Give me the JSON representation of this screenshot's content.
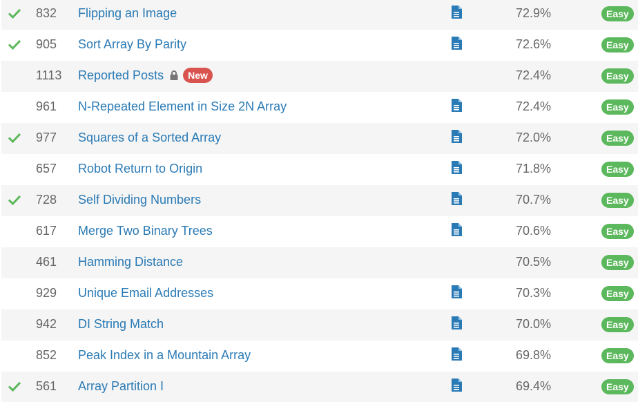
{
  "problems": [
    {
      "solved": true,
      "id": "832",
      "title": "Flipping an Image",
      "locked": false,
      "badge": "",
      "solution": true,
      "acceptance": "72.9%",
      "difficulty": "Easy"
    },
    {
      "solved": true,
      "id": "905",
      "title": "Sort Array By Parity",
      "locked": false,
      "badge": "",
      "solution": true,
      "acceptance": "72.6%",
      "difficulty": "Easy"
    },
    {
      "solved": false,
      "id": "1113",
      "title": "Reported Posts",
      "locked": true,
      "badge": "New",
      "solution": false,
      "acceptance": "72.4%",
      "difficulty": "Easy"
    },
    {
      "solved": false,
      "id": "961",
      "title": "N-Repeated Element in Size 2N Array",
      "locked": false,
      "badge": "",
      "solution": true,
      "acceptance": "72.4%",
      "difficulty": "Easy"
    },
    {
      "solved": true,
      "id": "977",
      "title": "Squares of a Sorted Array",
      "locked": false,
      "badge": "",
      "solution": true,
      "acceptance": "72.0%",
      "difficulty": "Easy"
    },
    {
      "solved": false,
      "id": "657",
      "title": "Robot Return to Origin",
      "locked": false,
      "badge": "",
      "solution": true,
      "acceptance": "71.8%",
      "difficulty": "Easy"
    },
    {
      "solved": true,
      "id": "728",
      "title": "Self Dividing Numbers",
      "locked": false,
      "badge": "",
      "solution": true,
      "acceptance": "70.7%",
      "difficulty": "Easy"
    },
    {
      "solved": false,
      "id": "617",
      "title": "Merge Two Binary Trees",
      "locked": false,
      "badge": "",
      "solution": true,
      "acceptance": "70.6%",
      "difficulty": "Easy"
    },
    {
      "solved": false,
      "id": "461",
      "title": "Hamming Distance",
      "locked": false,
      "badge": "",
      "solution": false,
      "acceptance": "70.5%",
      "difficulty": "Easy"
    },
    {
      "solved": false,
      "id": "929",
      "title": "Unique Email Addresses",
      "locked": false,
      "badge": "",
      "solution": true,
      "acceptance": "70.3%",
      "difficulty": "Easy"
    },
    {
      "solved": false,
      "id": "942",
      "title": "DI String Match",
      "locked": false,
      "badge": "",
      "solution": true,
      "acceptance": "70.0%",
      "difficulty": "Easy"
    },
    {
      "solved": false,
      "id": "852",
      "title": "Peak Index in a Mountain Array",
      "locked": false,
      "badge": "",
      "solution": true,
      "acceptance": "69.8%",
      "difficulty": "Easy"
    },
    {
      "solved": true,
      "id": "561",
      "title": "Array Partition I",
      "locked": false,
      "badge": "",
      "solution": true,
      "acceptance": "69.4%",
      "difficulty": "Easy"
    }
  ],
  "icons": {
    "solved": "check-icon",
    "locked": "lock-icon",
    "solution": "solution-document-icon"
  },
  "colors": {
    "link": "#2a7ab5",
    "check": "#5cb85c",
    "easy_badge": "#5cb85c",
    "new_badge": "#d9534f",
    "solution_icon": "#2a7ab5",
    "lock_icon": "#777777"
  }
}
